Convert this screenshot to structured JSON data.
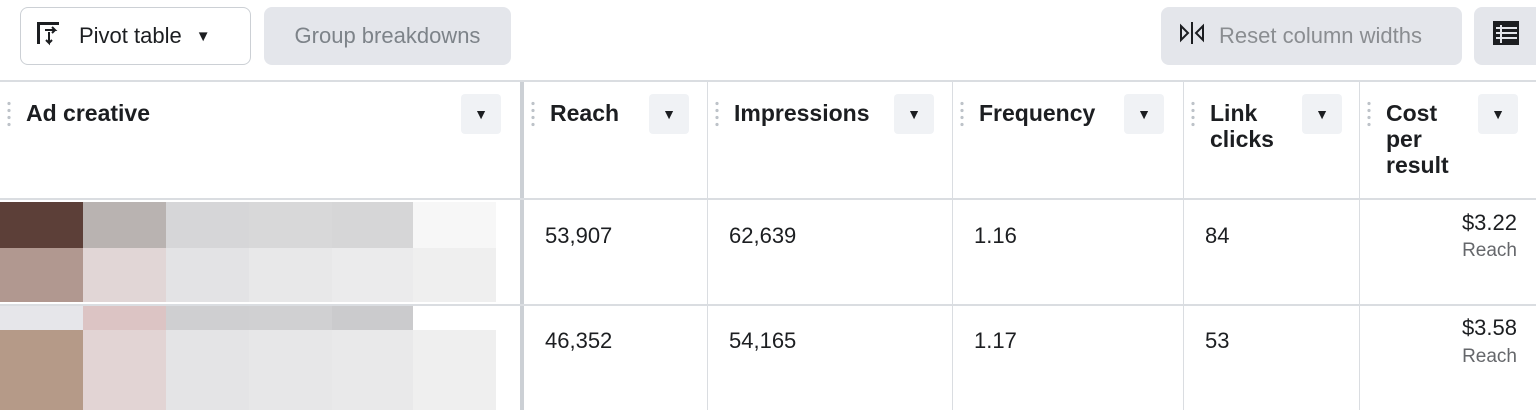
{
  "toolbar": {
    "pivot_label": "Pivot table",
    "pivot_icon": "pivot-table-icon",
    "group_breakdowns_label": "Group breakdowns",
    "reset_widths_label": "Reset column widths",
    "reset_icon": "resize-columns-icon",
    "columns_icon": "columns-grid-icon"
  },
  "table": {
    "columns": [
      {
        "key": "ad_creative",
        "label": "Ad creative"
      },
      {
        "key": "reach",
        "label": "Reach"
      },
      {
        "key": "impressions",
        "label": "Impressions"
      },
      {
        "key": "frequency",
        "label": "Frequency"
      },
      {
        "key": "link_clicks",
        "label": "Link\nclicks"
      },
      {
        "key": "cost_per_result",
        "label": "Cost\nper\nresult"
      }
    ],
    "rows": [
      {
        "reach": "53,907",
        "impressions": "62,639",
        "frequency": "1.16",
        "link_clicks": "84",
        "cost_per_result": "$3.22",
        "result_type": "Reach"
      },
      {
        "reach": "46,352",
        "impressions": "54,165",
        "frequency": "1.17",
        "link_clicks": "53",
        "cost_per_result": "$3.58",
        "result_type": "Reach"
      }
    ]
  },
  "colors": {
    "header_border": "#dadde1",
    "button_gray": "#e4e6eb",
    "text_primary": "#1c1e21",
    "text_secondary": "#65676b"
  }
}
